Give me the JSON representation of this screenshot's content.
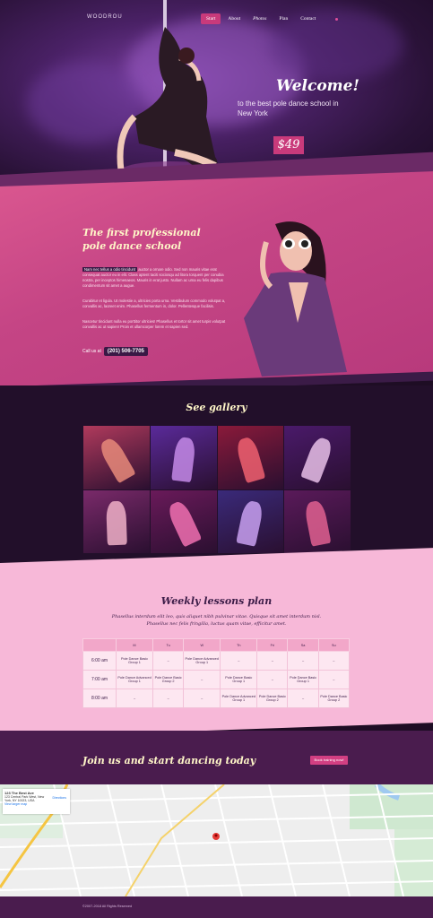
{
  "nav": {
    "logo": "WOODROU",
    "items": [
      {
        "label": "Start",
        "active": true
      },
      {
        "label": "About",
        "active": false
      },
      {
        "label": "Photos",
        "active": false
      },
      {
        "label": "Plan",
        "active": false
      },
      {
        "label": "Contact",
        "active": false
      }
    ]
  },
  "hero": {
    "welcome": "Welcome!",
    "subtitle": "to the best pole dance school in New York",
    "price": "$49"
  },
  "about": {
    "title": "The first professional pole dance school",
    "highlight": "Nam nec tellus a odio tincidunt",
    "p1": "auctor a ornare odio. Sed non mauris vitae erat consequat auctor eu in elit. Class aptent taciti sociosqu ad litora torquent per conubia nostra, per inceptos himenaeos. Mauris in erat justo. Nullam ac urna eu felis dapibus condimentum sit amet a augue.",
    "p2": "Curabitur et ligula. Ut molestie a, ultricies porta urna. Vestibulum commodo volutpat a, convallis ac, laoreet enim. Phasellus fermentum in, dolor. Pellentesque facilisis.",
    "p3": "Nascetur tincidunt nulla eu porttitor ultricies! Phasellus et tortor sit amet turpis volutpat convallis ac ut sapien! Proin et ullamcorper lorem et sapien sed.",
    "call_label": "Call us at",
    "phone": "(201) 506-7705"
  },
  "gallery": {
    "title": "See gallery",
    "tiles": [
      {
        "bg": "#b03a5c",
        "fig": "#e88a7a"
      },
      {
        "bg": "#5a2a9a",
        "fig": "#c48ae8"
      },
      {
        "bg": "#8a1a3a",
        "fig": "#f06070"
      },
      {
        "bg": "#4a1a6a",
        "fig": "#e8c0e8"
      },
      {
        "bg": "#7a2a6a",
        "fig": "#f0b0c8"
      },
      {
        "bg": "#6a1a5a",
        "fig": "#f070b0"
      },
      {
        "bg": "#3a2a7a",
        "fig": "#c8a0f0"
      },
      {
        "bg": "#5a1a5a",
        "fig": "#e06090"
      }
    ]
  },
  "schedule": {
    "title": "Weekly lessons plan",
    "subtitle": "Phasellus interdum elit leo, quis aliquet nibh pulvinar vitae. Quisque sit amet interdum nisl. Phasellus nec felis fringilla, luctus quam vitae, efficitur amet.",
    "days": [
      "",
      "M",
      "Tu",
      "W",
      "Th",
      "Fri",
      "Sa",
      "Su"
    ],
    "rows": [
      {
        "time": "6:00 am",
        "cells": [
          "Pole Dance Basic Group 1",
          "–",
          "Pole Dance Advanced Group 1",
          "–",
          "–",
          "–",
          "–"
        ]
      },
      {
        "time": "7:00 am",
        "cells": [
          "Pole Dance Advanced Group 1",
          "Pole Dance Basic Group 2",
          "–",
          "Pole Dance Basic Group 1",
          "–",
          "Pole Dance Basic Group 1",
          "–"
        ]
      },
      {
        "time": "8:00 am",
        "cells": [
          "–",
          "–",
          "–",
          "Pole Dance Advanced Group 1",
          "Pole Dance Basic Group 2",
          "–",
          "Pole Dance Basic Group 2"
        ]
      }
    ]
  },
  "join": {
    "title": "Join us and start dancing today",
    "button": "Book training now!"
  },
  "map": {
    "place": "123 The Best Ave",
    "address": "123 Central Park West, New York, NY 10023, USA",
    "directions": "Directions",
    "larger": "View larger map"
  },
  "footer": {
    "text": "©2007-2018 All Rights Reserved"
  }
}
